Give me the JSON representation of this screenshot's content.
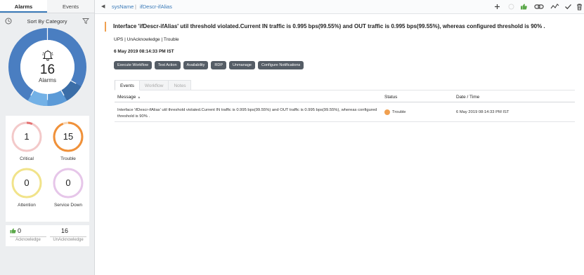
{
  "sidebar": {
    "tabs": [
      {
        "label": "Alarms",
        "active": true
      },
      {
        "label": "Events",
        "active": false
      }
    ],
    "category_title": "Sort By Category",
    "donut": {
      "count": "16",
      "label": "Alarms",
      "colors": [
        "#4a7ec1",
        "#5b9ad7",
        "#73b1e6",
        "#3b6ea8"
      ]
    },
    "severities": [
      {
        "count": "1",
        "label": "Critical",
        "color": "#e57373",
        "fraction": 0.06
      },
      {
        "count": "15",
        "label": "Trouble",
        "color": "#f0913a",
        "fraction": 0.94
      },
      {
        "count": "0",
        "label": "Attention",
        "color": "#f1e38a",
        "fraction": 0
      },
      {
        "count": "0",
        "label": "Service Down",
        "color": "#e6c6e9",
        "fraction": 0
      }
    ],
    "ack": {
      "acknowledge_count": "0",
      "acknowledge_label": "Acknowledge",
      "unacknowledge_count": "16",
      "unacknowledge_label": "UnAcknowledge"
    }
  },
  "topbar": {
    "breadcrumb": [
      "sysName",
      "ifDescr-ifAlias"
    ],
    "separator": "|",
    "icons": [
      "plus-icon",
      "circle-icon",
      "thumbs-up-icon",
      "link-icon",
      "graph-icon",
      "check-icon",
      "trash-icon"
    ]
  },
  "alarm": {
    "title": "Interface 'ifDescr-ifAlias' util threshold violated.Current IN traffic is 0.995 bps(99.55%) and OUT traffic is 0.995 bps(99.55%), whereas configured threshold is 90% .",
    "meta": "UPS | UnAcknowledge | Trouble",
    "timestamp": "6 May 2019 08:14:33 PM IST",
    "actions": [
      "Execute Workflow",
      "Test Action",
      "Availability",
      "RDP",
      "Unmanage",
      "Configure Notifications"
    ]
  },
  "tabs": [
    {
      "label": "Events",
      "active": true
    },
    {
      "label": "Workflow",
      "active": false
    },
    {
      "label": "Notes",
      "active": false
    }
  ],
  "table": {
    "headers": {
      "message": "Message",
      "status": "Status",
      "datetime": "Date / Time"
    },
    "rows": [
      {
        "message": "Interface 'ifDescr-ifAlias' util threshold violated.Current IN traffic is 0.995 bps(99.55%) and OUT traffic is 0.995 bps(99.55%), whereas configured threshold is 90% .",
        "status": "Trouble",
        "datetime": "6 May 2019 08:14:33 PM IST"
      }
    ]
  }
}
